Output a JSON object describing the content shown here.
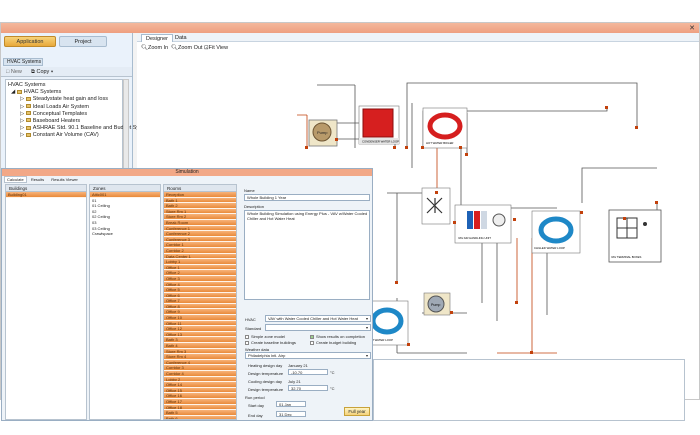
{
  "tabs": {
    "application": "Application",
    "project": "Project"
  },
  "left_panel": {
    "section_title": "HVAC Systems",
    "toolbar": {
      "new_label": "New",
      "copy_label": "Copy"
    },
    "tree": [
      "HVAC Systems",
      "HVAC Systems",
      "Steadystate heat gain and loss",
      "Ideal Loads Air System",
      "Conceptual Templates",
      "Baseboard Heaters",
      "ASHRAE Std. 90.1 Baseline and Budget Sy",
      "Constant Air Volume (CAV)"
    ]
  },
  "designer": {
    "tabs": [
      "Designer",
      "Data"
    ],
    "toolbar": {
      "zoom_in": "Zoom In",
      "zoom_out": "Zoom Out",
      "fit_view": "Fit View"
    }
  },
  "simulation": {
    "title": "Simulation",
    "tabs": [
      "Calculate",
      "Results",
      "Results Viewer"
    ],
    "buildings_header": "Buildings",
    "buildings": [
      "Building01"
    ],
    "zones_header": "Zones",
    "zones": [
      "Attic001",
      "01",
      "01 Ceiling",
      "02",
      "02 Ceiling",
      "03",
      "03 Ceiling",
      "Crawlspace"
    ],
    "rooms_header": "Rooms",
    "rooms": [
      "Reception",
      "Bath 1",
      "Bath 2",
      "Store Rm 1",
      "Store Rm 2",
      "Break Room",
      "Conference 1",
      "Conference 2",
      "Conference 3",
      "Corridor 1",
      "Corridor 2",
      "Data Center 1",
      "Lobby 1",
      "Office 1",
      "Office 2",
      "Office 3",
      "Office 4",
      "Office 5",
      "Office 6",
      "Office 7",
      "Office 8",
      "Office 9",
      "Office 10",
      "Office 11",
      "Office 12",
      "Office 13",
      "Bath 3",
      "Bath 4",
      "Store Rm 3",
      "Store Rm 4",
      "Conference 4",
      "Corridor 3",
      "Corridor 4",
      "Lobby 2",
      "Office 14",
      "Office 15",
      "Office 16",
      "Office 17",
      "Office 18",
      "Bath 5",
      "Bath 6",
      "Store Rm 5",
      "Store Rm 6",
      "Office 19",
      "Office 20"
    ],
    "name_label": "Name",
    "name_value": "Whole Building 1 Year",
    "description_label": "Description",
    "description_value": "Whole Building Simulation using Energy Plus - VAV w/Water Cooled Chiller and Hot Water Heat",
    "hvac_label": "HVAC",
    "hvac_value": "VAV with Water Cooled Chiller and Hot Water Heat",
    "standard_label": "Standard",
    "standard_value": "",
    "opt_simple": "Simple zone model",
    "opt_baseline": "Create baseline buildings",
    "opt_results": "Show results on completion",
    "opt_budget": "Create budget building",
    "weather_label": "Weather data",
    "weather_value": "Philadelphia Intl. Airp",
    "heating_day_label": "Heating design day",
    "heating_day_value": "January 21",
    "design_temp_label": "Design temperature",
    "heating_temp_value": "-10.70",
    "cooling_day_label": "Cooling design day",
    "cooling_day_value": "July 21",
    "cooling_temp_value": "32.70",
    "unit": "°C",
    "run_period_label": "Run period",
    "start_day_label": "Start day",
    "start_day_value": "01 Jan",
    "end_day_label": "End day",
    "end_day_value": "31 Dec",
    "full_year_button": "Full year"
  },
  "diagram": {
    "pump_label": "Pump",
    "chiller_caption": "CONDENSER WATER LOOP",
    "boiler_caption": "HOT WATER BOILER",
    "loop_caption": "CHILLED WATER LOOP",
    "tower_caption": "COOLING TOWER",
    "ahu_caption": "VAV AIR HANDLING UNIT",
    "hw_loop_caption": "HOT WATER LOOP",
    "vav_caption": "VAV TERMINAL BOXES",
    "hw_pump_caption": "HOT WATER PUMP"
  },
  "colors": {
    "accent": "#ee9f80",
    "node": "#c2410c",
    "loop": "#1e88c7",
    "orange_row": "#e98a3a"
  }
}
